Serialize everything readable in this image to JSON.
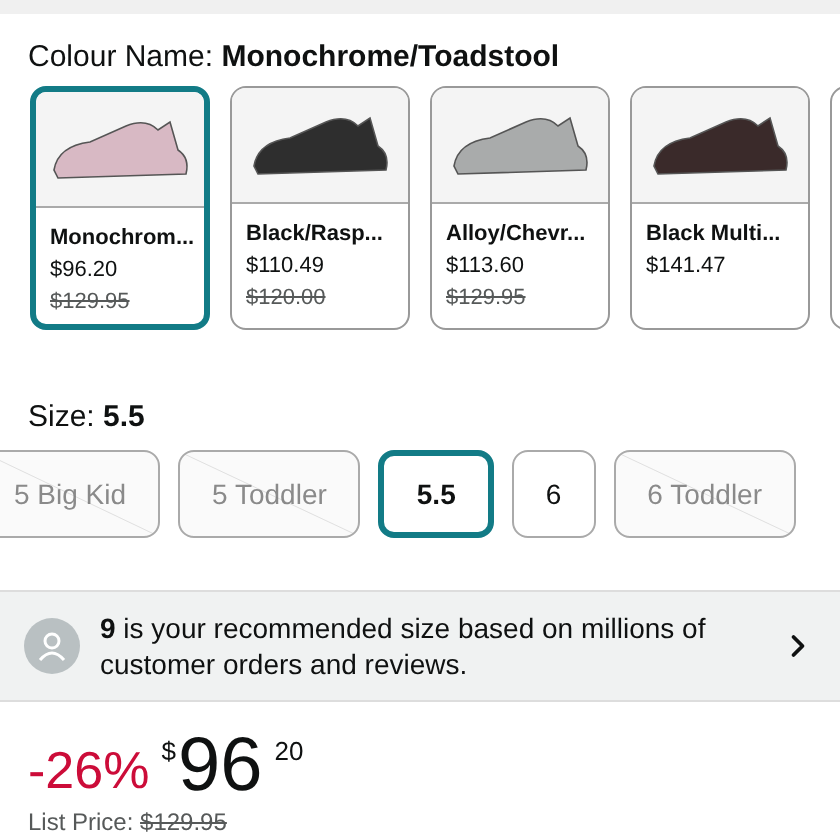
{
  "colour": {
    "label": "Colour Name:",
    "value": "Monochrome/Toadstool"
  },
  "swatches": [
    {
      "name": "Monochrom...",
      "price": "$96.20",
      "list_price": "$129.95",
      "selected": true,
      "color": "#d8b9c4"
    },
    {
      "name": "Black/Rasp...",
      "price": "$110.49",
      "list_price": "$120.00",
      "selected": false,
      "color": "#2e2e2e"
    },
    {
      "name": "Alloy/Chevr...",
      "price": "$113.60",
      "list_price": "$129.95",
      "selected": false,
      "color": "#a9abab"
    },
    {
      "name": "Black Multi...",
      "price": "$141.47",
      "selected": false,
      "color": "#3a2a2a"
    }
  ],
  "size": {
    "label": "Size:",
    "value": "5.5"
  },
  "sizes": [
    {
      "label": "5 Big Kid",
      "available": false,
      "selected": false
    },
    {
      "label": "5 Toddler",
      "available": false,
      "selected": false
    },
    {
      "label": "5.5",
      "available": true,
      "selected": true
    },
    {
      "label": "6",
      "available": true,
      "selected": false
    },
    {
      "label": "6 Toddler",
      "available": false,
      "selected": false
    }
  ],
  "recommendation": {
    "text": "**9** is your recommended size based on millions of customer orders and reviews."
  },
  "price": {
    "discount": "-26%",
    "currency": "$",
    "whole": "96",
    "fraction": "20",
    "list_label": "List Price:",
    "list_price": "$129.95"
  }
}
